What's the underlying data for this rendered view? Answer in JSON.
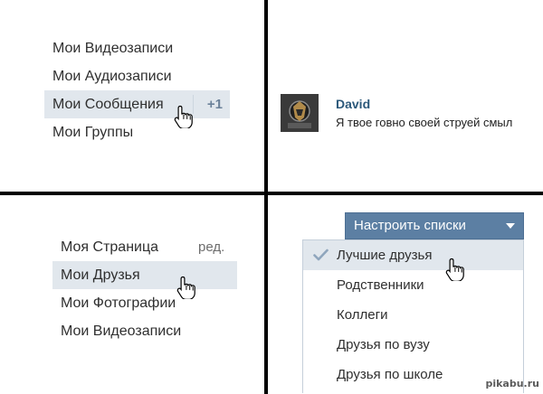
{
  "panel1": {
    "menu": [
      {
        "label": "Мои Видеозаписи"
      },
      {
        "label": "Мои Аудиозаписи"
      },
      {
        "label": "Мои Сообщения",
        "counter": "+1",
        "active": true
      },
      {
        "label": "Мои Группы"
      }
    ]
  },
  "panel2": {
    "message": {
      "author": "David",
      "text": "Я твое говно своей струей смыл"
    }
  },
  "panel3": {
    "edit_link": "ред.",
    "menu": [
      {
        "label": "Моя Страница"
      },
      {
        "label": "Мои Друзья",
        "active": true
      },
      {
        "label": "Мои Фотографии"
      },
      {
        "label": "Мои Видеозаписи"
      }
    ]
  },
  "panel4": {
    "dropdown_button": "Настроить списки",
    "dropdown_icon": "caret-down-icon",
    "options": [
      {
        "label": "Лучшие друзья",
        "checked": true
      },
      {
        "label": "Родственники"
      },
      {
        "label": "Коллеги"
      },
      {
        "label": "Друзья по вузу"
      },
      {
        "label": "Друзья по школе"
      }
    ]
  },
  "watermark": "pikabu.ru",
  "colors": {
    "highlight": "#e1e7ed",
    "button": "#5c7fa3",
    "author_link": "#2b587a",
    "counter": "#6b8199"
  }
}
